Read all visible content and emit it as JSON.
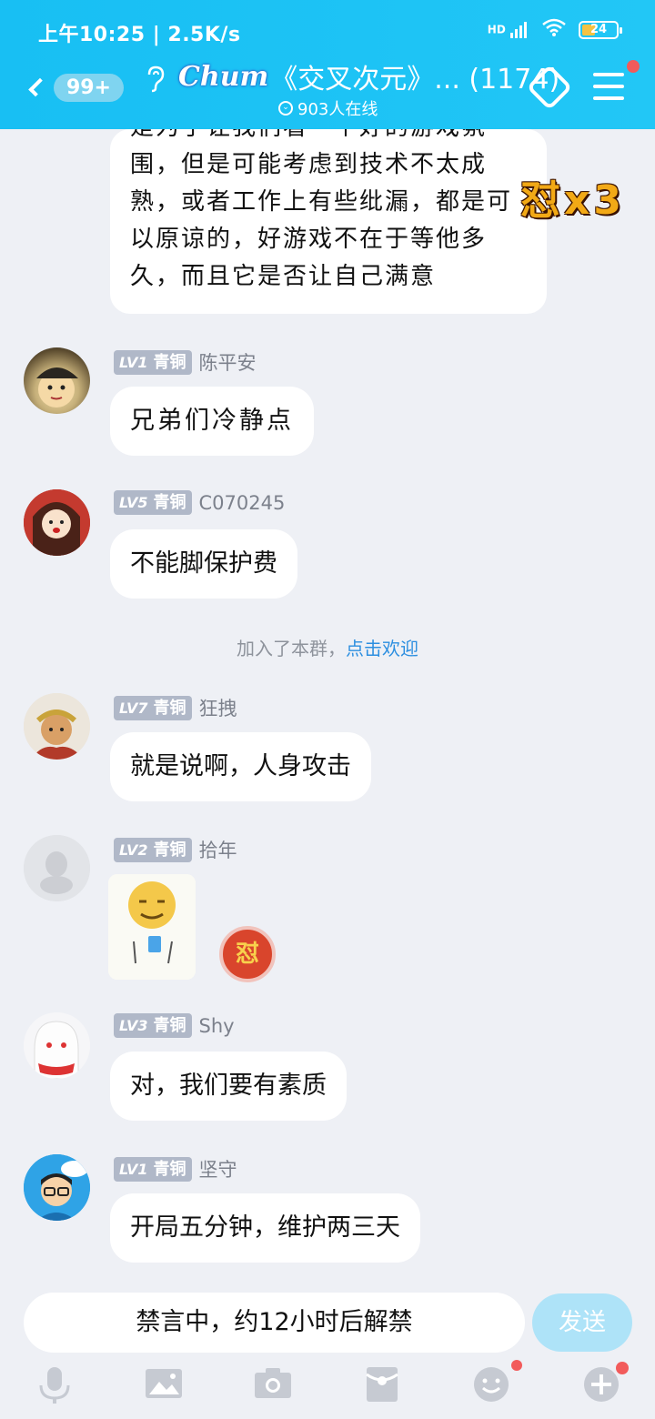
{
  "status": {
    "time": "上午10:25 | 2.5K/s",
    "battery": "24",
    "network": "HD"
  },
  "header": {
    "unread_badge": "99+",
    "logo": "Chum",
    "title": "《交叉次元》... (1174)",
    "online": "903人在线"
  },
  "partial_message": {
    "text": "是为了让我们看一个好的游戏氛围，但是可能考虑到技术不太成熟，或者工作上有些纰漏，都是可以原谅的，好游戏不在于等他多久，而且它是否让自己满意"
  },
  "combo": "怼x3",
  "messages": [
    {
      "level": "LV1",
      "rank": "青铜",
      "name": "陈平安",
      "text": "兄弟们冷静点"
    },
    {
      "level": "LV5",
      "rank": "青铜",
      "name": "C070245",
      "text": "不能脚保护费"
    },
    {
      "level": "LV7",
      "rank": "青铜",
      "name": "狂拽",
      "text": "就是说啊，人身攻击"
    },
    {
      "level": "LV2",
      "rank": "青铜",
      "name": "拾年",
      "text": ""
    },
    {
      "level": "LV3",
      "rank": "青铜",
      "name": "Shy",
      "text": "对，我们要有素质"
    },
    {
      "level": "LV1",
      "rank": "青铜",
      "name": "坚守",
      "text": "开局五分钟，维护两三天"
    }
  ],
  "system": {
    "text": "加入了本群，",
    "link": "点击欢迎"
  },
  "reaction_badge": "怼",
  "input": {
    "text": "禁言中，约12小时后解禁",
    "send_label": "发送"
  },
  "colors": {
    "header": "#1dc3f5",
    "background": "#eef0f5",
    "link": "#2d8fe0",
    "badge_red": "#f25b5b"
  }
}
